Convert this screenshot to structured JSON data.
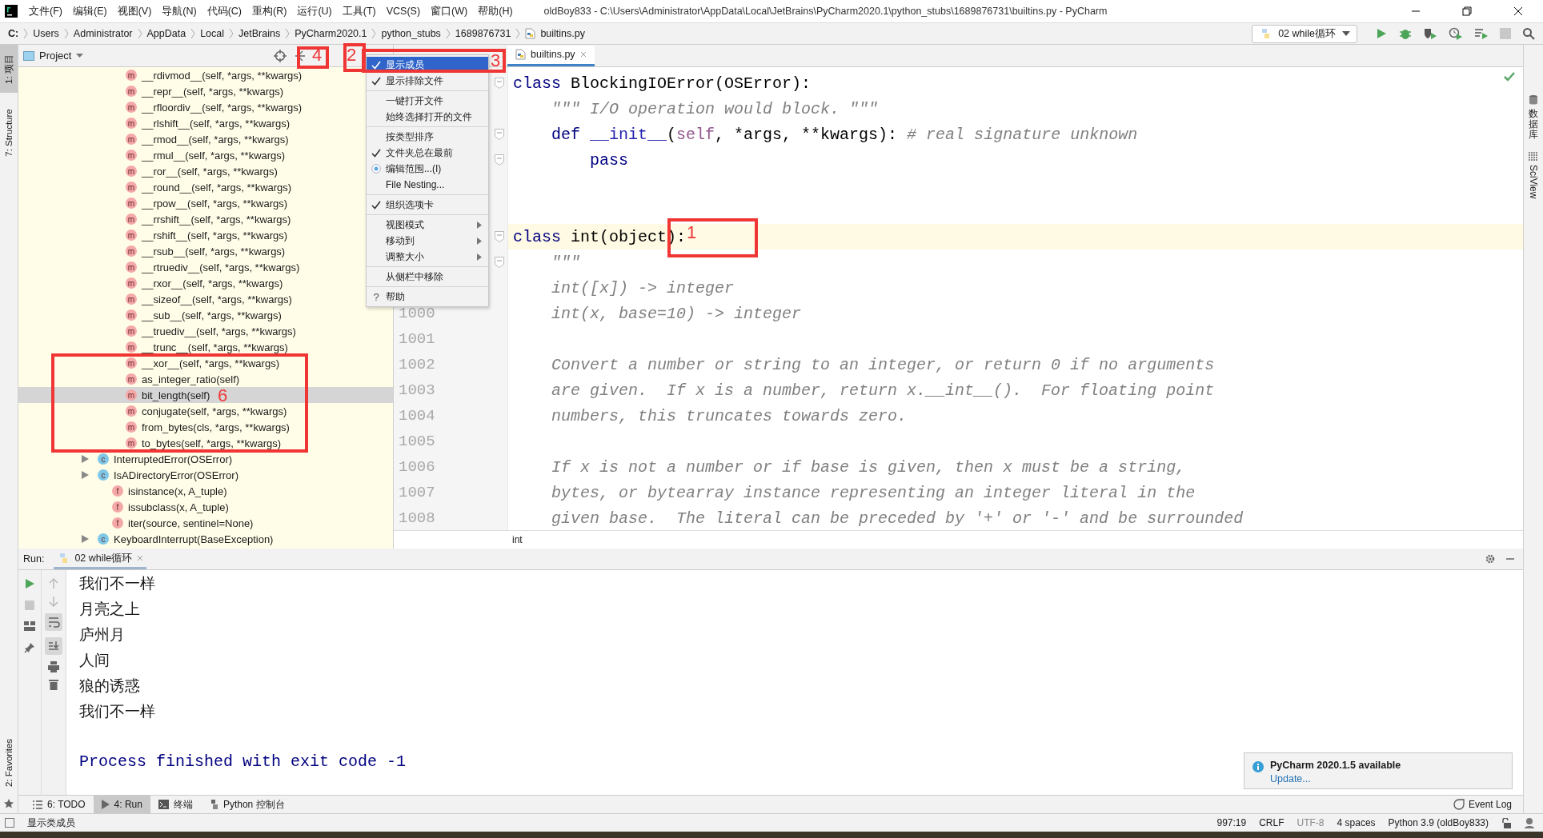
{
  "window": {
    "title": "oldBoy833 - C:\\Users\\Administrator\\AppData\\Local\\JetBrains\\PyCharm2020.1\\python_stubs\\1689876731\\builtins.py - PyCharm"
  },
  "menu_bar": [
    "文件(F)",
    "编辑(E)",
    "视图(V)",
    "导航(N)",
    "代码(C)",
    "重构(R)",
    "运行(U)",
    "工具(T)",
    "VCS(S)",
    "窗口(W)",
    "帮助(H)"
  ],
  "breadcrumbs": [
    "C:",
    "Users",
    "Administrator",
    "AppData",
    "Local",
    "JetBrains",
    "PyCharm2020.1",
    "python_stubs",
    "1689876731",
    "builtins.py"
  ],
  "run_config": "02 while循环",
  "left_stripe": [
    {
      "label": "1: 项目",
      "selected": true
    },
    {
      "label": "7: Structure",
      "selected": false
    }
  ],
  "favorites": "2: Favorites",
  "right_stripe": {
    "database": "数据库",
    "sciview": "SciView"
  },
  "project_panel": {
    "title": "Project",
    "tree": [
      {
        "kind": "method",
        "badge": "m",
        "label": "__rdivmod__(self, *args, **kwargs)",
        "selected": false
      },
      {
        "kind": "method",
        "badge": "m",
        "label": "__repr__(self, *args, **kwargs)",
        "selected": false
      },
      {
        "kind": "method",
        "badge": "m",
        "label": "__rfloordiv__(self, *args, **kwargs)",
        "selected": false
      },
      {
        "kind": "method",
        "badge": "m",
        "label": "__rlshift__(self, *args, **kwargs)",
        "selected": false
      },
      {
        "kind": "method",
        "badge": "m",
        "label": "__rmod__(self, *args, **kwargs)",
        "selected": false
      },
      {
        "kind": "method",
        "badge": "m",
        "label": "__rmul__(self, *args, **kwargs)",
        "selected": false
      },
      {
        "kind": "method",
        "badge": "m",
        "label": "__ror__(self, *args, **kwargs)",
        "selected": false
      },
      {
        "kind": "method",
        "badge": "m",
        "label": "__round__(self, *args, **kwargs)",
        "selected": false
      },
      {
        "kind": "method",
        "badge": "m",
        "label": "__rpow__(self, *args, **kwargs)",
        "selected": false
      },
      {
        "kind": "method",
        "badge": "m",
        "label": "__rrshift__(self, *args, **kwargs)",
        "selected": false
      },
      {
        "kind": "method",
        "badge": "m",
        "label": "__rshift__(self, *args, **kwargs)",
        "selected": false
      },
      {
        "kind": "method",
        "badge": "m",
        "label": "__rsub__(self, *args, **kwargs)",
        "selected": false
      },
      {
        "kind": "method",
        "badge": "m",
        "label": "__rtruediv__(self, *args, **kwargs)",
        "selected": false
      },
      {
        "kind": "method",
        "badge": "m",
        "label": "__rxor__(self, *args, **kwargs)",
        "selected": false
      },
      {
        "kind": "method",
        "badge": "m",
        "label": "__sizeof__(self, *args, **kwargs)",
        "selected": false
      },
      {
        "kind": "method",
        "badge": "m",
        "label": "__sub__(self, *args, **kwargs)",
        "selected": false
      },
      {
        "kind": "method",
        "badge": "m",
        "label": "__truediv__(self, *args, **kwargs)",
        "selected": false
      },
      {
        "kind": "method",
        "badge": "m",
        "label": "__trunc__(self, *args, **kwargs)",
        "selected": false
      },
      {
        "kind": "method",
        "badge": "m",
        "label": "__xor__(self, *args, **kwargs)",
        "selected": false
      },
      {
        "kind": "method",
        "badge": "m",
        "label": "as_integer_ratio(self)",
        "selected": false
      },
      {
        "kind": "method",
        "badge": "m",
        "label": "bit_length(self)",
        "selected": true
      },
      {
        "kind": "method",
        "badge": "m",
        "label": "conjugate(self, *args, **kwargs)",
        "selected": false
      },
      {
        "kind": "method",
        "badge": "m",
        "label": "from_bytes(cls, *args, **kwargs)",
        "selected": false
      },
      {
        "kind": "method",
        "badge": "m",
        "label": "to_bytes(self, *args, **kwargs)",
        "selected": false
      },
      {
        "kind": "class",
        "badge": "c",
        "label": "InterruptedError(OSError)",
        "selected": false
      },
      {
        "kind": "class",
        "badge": "c",
        "label": "IsADirectoryError(OSError)",
        "selected": false
      },
      {
        "kind": "function",
        "badge": "f",
        "label": "isinstance(x, A_tuple)",
        "selected": false
      },
      {
        "kind": "function",
        "badge": "f",
        "label": "issubclass(x, A_tuple)",
        "selected": false
      },
      {
        "kind": "function",
        "badge": "f",
        "label": "iter(source, sentinel=None)",
        "selected": false
      },
      {
        "kind": "class",
        "badge": "c",
        "label": "KeyboardInterrupt(BaseException)",
        "selected": false
      }
    ]
  },
  "popup_menu": [
    {
      "kind": "item",
      "label": "显示成员",
      "checked": true,
      "selected": true
    },
    {
      "kind": "item",
      "label": "显示排除文件",
      "checked": true,
      "selected": false
    },
    {
      "kind": "separator"
    },
    {
      "kind": "item",
      "label": "一键打开文件",
      "checked": false,
      "selected": false
    },
    {
      "kind": "item",
      "label": "始终选择打开的文件",
      "checked": false,
      "selected": false
    },
    {
      "kind": "separator"
    },
    {
      "kind": "item",
      "label": "按类型排序",
      "checked": false,
      "selected": false
    },
    {
      "kind": "item",
      "label": "文件夹总在最前",
      "checked": true,
      "selected": false
    },
    {
      "kind": "radio",
      "label": "编辑范围...(I)",
      "selected": false
    },
    {
      "kind": "item",
      "label": "File Nesting...",
      "checked": false,
      "selected": false
    },
    {
      "kind": "separator"
    },
    {
      "kind": "item",
      "label": "组织选项卡",
      "checked": true,
      "selected": false
    },
    {
      "kind": "separator"
    },
    {
      "kind": "submenu",
      "label": "视图模式",
      "selected": false
    },
    {
      "kind": "submenu",
      "label": "移动到",
      "selected": false
    },
    {
      "kind": "submenu",
      "label": "调整大小",
      "selected": false
    },
    {
      "kind": "separator"
    },
    {
      "kind": "item",
      "label": "从侧栏中移除",
      "checked": false,
      "selected": false
    },
    {
      "kind": "separator"
    },
    {
      "kind": "help",
      "glyph": "?",
      "label": "帮助",
      "selected": false
    }
  ],
  "editor": {
    "tab": "builtins.py",
    "breadcrumb": "int",
    "lines": [
      {
        "current": false,
        "fold": true,
        "tokens": [
          {
            "kind": "keyword",
            "text": "class "
          },
          {
            "kind": "plain",
            "text": "BlockingIOError(OSError):"
          }
        ]
      },
      {
        "current": false,
        "fold": false,
        "tokens": [
          {
            "kind": "doc",
            "text": "    \"\"\" I/O operation would block. \"\"\""
          }
        ]
      },
      {
        "current": false,
        "fold": true,
        "tokens": [
          {
            "kind": "keyword",
            "text": "    def "
          },
          {
            "kind": "magic",
            "text": "__init__"
          },
          {
            "kind": "plain",
            "text": "("
          },
          {
            "kind": "self",
            "text": "self"
          },
          {
            "kind": "plain",
            "text": ", *args, **kwargs): "
          },
          {
            "kind": "comment",
            "text": "# real signature unknown"
          }
        ]
      },
      {
        "current": false,
        "fold": true,
        "tokens": [
          {
            "kind": "keyword",
            "text": "        pass"
          }
        ]
      },
      {
        "current": false,
        "fold": false
      },
      {
        "current": false,
        "fold": false
      },
      {
        "current": true,
        "fold": true,
        "tokens": [
          {
            "kind": "keyword",
            "text": "class "
          },
          {
            "kind": "plain",
            "text": "int(object):"
          }
        ]
      },
      {
        "current": false,
        "fold": true,
        "tokens": [
          {
            "kind": "doc",
            "text": "    \"\"\""
          }
        ]
      },
      {
        "current": false,
        "fold": false,
        "tokens": [
          {
            "kind": "doc",
            "text": "    int([x]) -> integer"
          }
        ]
      },
      {
        "number": "1000",
        "current": false,
        "fold": false,
        "tokens": [
          {
            "kind": "doc",
            "text": "    int(x, base=10) -> integer"
          }
        ]
      },
      {
        "number": "1001",
        "current": false,
        "fold": false
      },
      {
        "number": "1002",
        "current": false,
        "fold": false,
        "tokens": [
          {
            "kind": "doc",
            "text": "    Convert a number or string to an integer, or return 0 if no arguments"
          }
        ]
      },
      {
        "number": "1003",
        "current": false,
        "fold": false,
        "tokens": [
          {
            "kind": "doc",
            "text": "    are given.  If x is a number, return x.__int__().  For floating point"
          }
        ]
      },
      {
        "number": "1004",
        "current": false,
        "fold": false,
        "tokens": [
          {
            "kind": "doc",
            "text": "    numbers, this truncates towards zero."
          }
        ]
      },
      {
        "number": "1005",
        "current": false,
        "fold": false
      },
      {
        "number": "1006",
        "current": false,
        "fold": false,
        "tokens": [
          {
            "kind": "doc",
            "text": "    If x is not a number or if base is given, then x must be a string,"
          }
        ]
      },
      {
        "number": "1007",
        "current": false,
        "fold": false,
        "tokens": [
          {
            "kind": "doc",
            "text": "    bytes, or bytearray instance representing an integer literal in the"
          }
        ]
      },
      {
        "number": "1008",
        "current": false,
        "fold": false,
        "tokens": [
          {
            "kind": "doc",
            "text": "    given base.  The literal can be preceded by '+' or '-' and be surrounded"
          }
        ]
      }
    ]
  },
  "run_panel": {
    "label": "Run:",
    "tab": "02 while循环",
    "output": [
      "我们不一样",
      "月亮之上",
      "庐州月",
      "人间",
      "狼的诱惑",
      "我们不一样"
    ],
    "exit_message": "Process finished with exit code -1"
  },
  "notification": {
    "title": "PyCharm 2020.1.5 available",
    "link": "Update..."
  },
  "tool_tabs": [
    {
      "label": "6: TODO",
      "kind": "todo",
      "selected": false
    },
    {
      "label": "4: Run",
      "kind": "run",
      "selected": true
    },
    {
      "label": "终端",
      "kind": "terminal",
      "selected": false
    },
    {
      "label": "Python 控制台",
      "kind": "console",
      "selected": false
    }
  ],
  "event_log": "Event Log",
  "status_bar": {
    "message": "显示类成员",
    "position": "997:19",
    "line_separator": "CRLF",
    "encoding": "UTF-8",
    "indent": "4 spaces",
    "interpreter": "Python 3.9 (oldBoy833)"
  },
  "annotations": [
    {
      "label": "4"
    },
    {
      "label": "2"
    },
    {
      "label": "3"
    },
    {
      "label": "1"
    },
    {
      "label": "6"
    }
  ]
}
